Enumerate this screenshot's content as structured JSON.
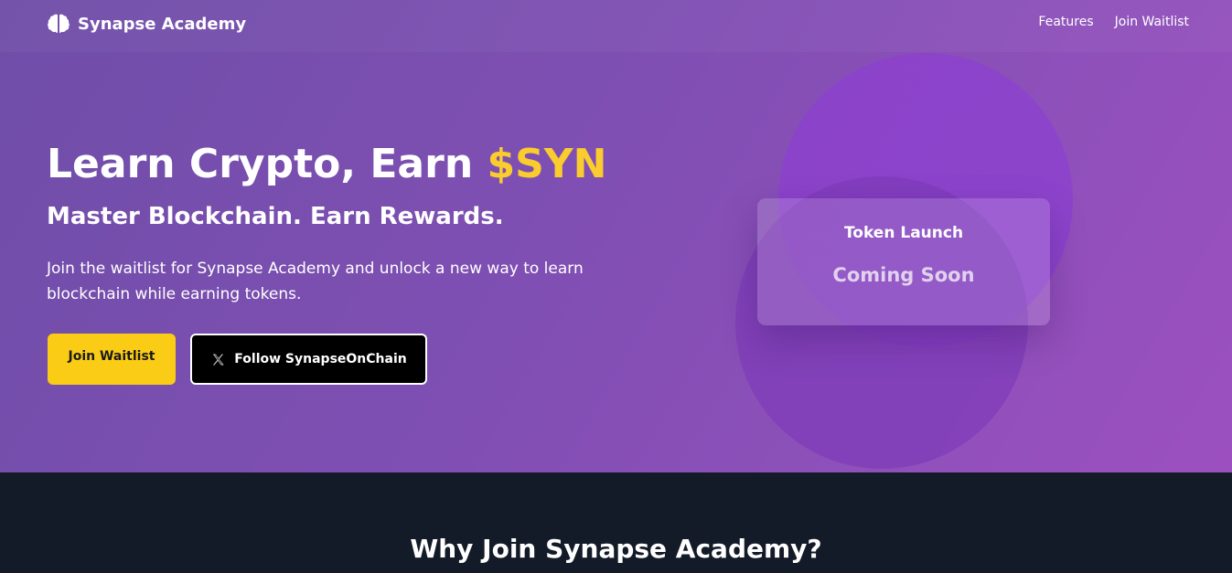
{
  "brand": {
    "name": "Synapse Academy",
    "logo_icon": "brain-icon"
  },
  "nav": {
    "links": [
      {
        "label": "Features"
      },
      {
        "label": "Join Waitlist"
      }
    ]
  },
  "hero": {
    "headline_prefix": "Learn Crypto, Earn ",
    "headline_accent": "$SYN",
    "subheadline": "Master Blockchain. Earn Rewards.",
    "description": "Join the waitlist for Synapse Academy and unlock a new way to learn blockchain while earning tokens.",
    "buttons": {
      "waitlist_label": "Join Waitlist",
      "follow_label": "Follow SynapseOnChain",
      "follow_icon": "x-logo-icon"
    }
  },
  "token_card": {
    "title": "Token Launch",
    "status": "Coming Soon"
  },
  "features_section": {
    "title": "Why Join Synapse Academy?"
  },
  "colors": {
    "accent": "#facc2e",
    "button_primary": "#facc15",
    "hero_gradient_start": "#6f4ea8",
    "hero_gradient_end": "#9c50c0",
    "footer_background": "#131a28"
  }
}
